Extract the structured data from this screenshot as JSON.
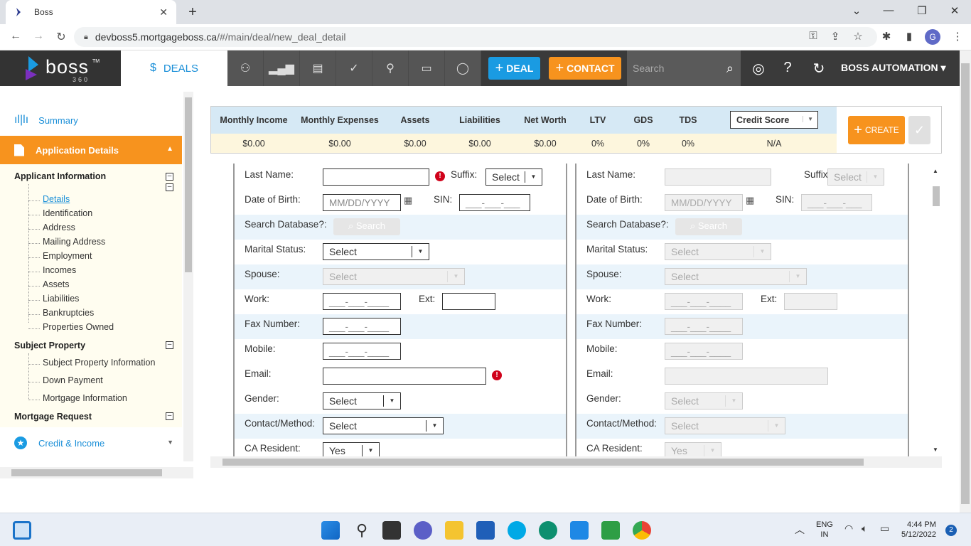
{
  "browser": {
    "tab_title": "Boss",
    "url_host": "devboss5.mortgageboss.ca",
    "url_path": "/#/main/deal/new_deal_detail",
    "profile_initial": "G"
  },
  "header": {
    "logo_word": "boss",
    "logo_tm": "TM",
    "logo_sub": "360",
    "deals_label": "DEALS",
    "deal_button": "DEAL",
    "contact_button": "CONTACT",
    "search_placeholder": "Search",
    "user_label": "BOSS AUTOMATION",
    "colors": {
      "blue": "#1a9be2",
      "orange": "#f7931e",
      "dark": "#3a3a3a"
    }
  },
  "sidebar": {
    "summary": "Summary",
    "application_details": "Application Details",
    "groups": {
      "applicant": "Applicant Information",
      "subject": "Subject Property",
      "mortgage": "Mortgage Request"
    },
    "applicant_items": [
      "Details",
      "Identification",
      "Address",
      "Mailing Address",
      "Employment",
      "Incomes",
      "Assets",
      "Liabilities",
      "Bankruptcies",
      "Properties Owned"
    ],
    "subject_items": [
      "Subject Property Information",
      "Down Payment",
      "Mortgage Information"
    ],
    "credit_income": "Credit & Income"
  },
  "summary": {
    "headers": [
      "Monthly Income",
      "Monthly Expenses",
      "Assets",
      "Liabilities",
      "Net Worth",
      "LTV",
      "GDS",
      "TDS"
    ],
    "values": [
      "$0.00",
      "$0.00",
      "$0.00",
      "$0.00",
      "$0.00",
      "0%",
      "0%",
      "0%"
    ],
    "credit_score_label": "Credit Score",
    "credit_score_value": "N/A",
    "create_button": "CREATE"
  },
  "form": {
    "labels": {
      "last_name": "Last Name:",
      "suffix": "Suffix:",
      "dob": "Date of Birth:",
      "sin": "SIN:",
      "search_db": "Search Database?:",
      "marital": "Marital Status:",
      "spouse": "Spouse:",
      "work": "Work:",
      "ext": "Ext:",
      "fax": "Fax Number:",
      "mobile": "Mobile:",
      "email": "Email:",
      "gender": "Gender:",
      "contact_method": "Contact/Method:",
      "ca_resident": "CA Resident:"
    },
    "select_text": "Select",
    "dob_placeholder": "MM/DD/YYYY",
    "sin_placeholder": "___-___-___",
    "phone_placeholder": "___-___-____",
    "search_button": "Search",
    "ca_resident_value": "Yes"
  },
  "taskbar": {
    "lang_line1": "ENG",
    "lang_line2": "IN",
    "time": "4:44 PM",
    "date": "5/12/2022",
    "notification_count": "2"
  }
}
